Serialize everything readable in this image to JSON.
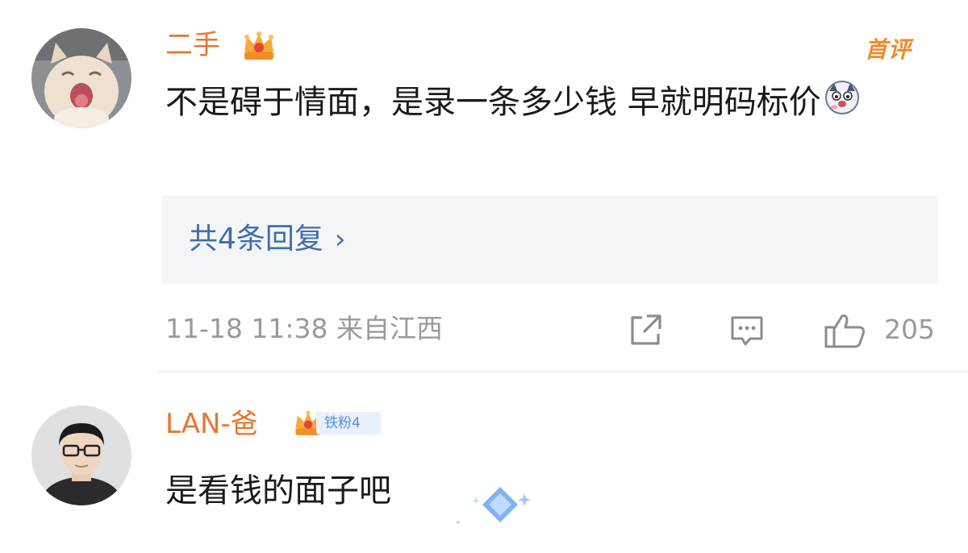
{
  "comments": [
    {
      "username": "二手",
      "text": "不是碍于情面，是录一条多少钱 早就明码标价",
      "first_badge": "首评",
      "replies_label": "共4条回复",
      "timestamp": "11-18 11:38 来自江西",
      "like_count": "205"
    },
    {
      "username": "LAN-爸",
      "fan_badge": "铁粉4",
      "text": "是看钱的面子吧"
    }
  ],
  "colors": {
    "username": "#e8762d",
    "link": "#3f6fa8",
    "meta": "#9a9a9a",
    "reply_bg": "#f4f5f7"
  }
}
